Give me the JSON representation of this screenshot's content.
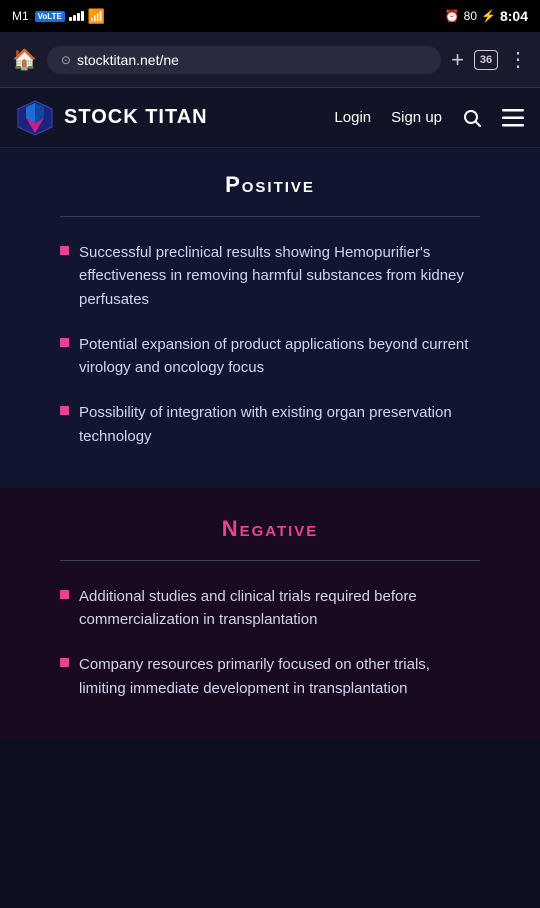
{
  "statusBar": {
    "carrier": "M1",
    "volte": "VoLTE",
    "signalBars": 4,
    "wifiStrength": "full",
    "alarmIcon": "⏰",
    "batteryPercent": "80",
    "chargingIcon": "⚡",
    "time": "8:04"
  },
  "browser": {
    "urlText": "stocktitan.net/ne",
    "tabsCount": "36",
    "homeIcon": "⌂",
    "plusIcon": "+",
    "moreIcon": "⋮"
  },
  "navbar": {
    "logoText": "STOCK TITAN",
    "loginLabel": "Login",
    "signupLabel": "Sign up",
    "searchIcon": "search",
    "menuIcon": "menu"
  },
  "positive": {
    "heading": "Positive",
    "divider": true,
    "items": [
      "Successful preclinical results showing Hemopurifier's effectiveness in removing harmful substances from kidney perfusates",
      "Potential expansion of product applications beyond current virology and oncology focus",
      "Possibility of integration with existing organ preservation technology"
    ]
  },
  "negative": {
    "heading": "Negative",
    "divider": true,
    "items": [
      "Additional studies and clinical trials required before commercialization in transplantation",
      "Company resources primarily focused on other trials, limiting immediate development in transplantation"
    ]
  }
}
